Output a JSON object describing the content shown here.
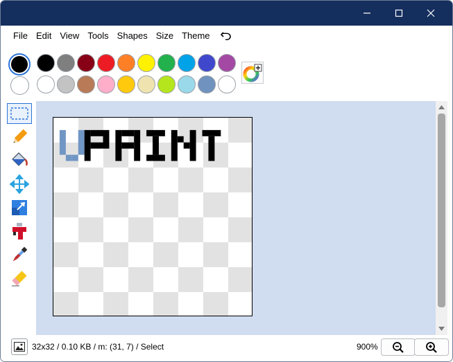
{
  "window": {
    "title": "",
    "controls": {
      "minimize": "minimize-icon",
      "maximize": "maximize-icon",
      "close": "close-icon"
    }
  },
  "menu": {
    "items": [
      "File",
      "Edit",
      "View",
      "Tools",
      "Shapes",
      "Size",
      "Theme"
    ],
    "undo_icon": "undo-icon"
  },
  "palette": {
    "primary_color": "#000000",
    "secondary_color": "#ffffff",
    "row1": [
      "#000000",
      "#7f7f7f",
      "#880015",
      "#ed1c24",
      "#ff7f27",
      "#fff200",
      "#22b14c",
      "#00a2e8",
      "#3f48cc",
      "#a349a4"
    ],
    "row2": [
      "#ffffff",
      "#c3c3c3",
      "#b97a57",
      "#ffaec9",
      "#ffc90e",
      "#efe4b0",
      "#b5e61d",
      "#99d9ea",
      "#7092be",
      "#ffffff"
    ],
    "picker_icon": "color-wheel-icon"
  },
  "tools": [
    {
      "name": "select",
      "icon": "select-rect-icon",
      "active": true
    },
    {
      "name": "pencil",
      "icon": "pencil-icon",
      "active": false
    },
    {
      "name": "fill",
      "icon": "paint-bucket-icon",
      "active": false
    },
    {
      "name": "move",
      "icon": "move-arrows-icon",
      "active": false
    },
    {
      "name": "resize",
      "icon": "resize-icon",
      "active": false
    },
    {
      "name": "spray",
      "icon": "spray-can-icon",
      "active": false
    },
    {
      "name": "eyedropper",
      "icon": "eyedropper-icon",
      "active": false
    },
    {
      "name": "eraser",
      "icon": "eraser-icon",
      "active": false
    }
  ],
  "canvas": {
    "logo_text": "VPAINT"
  },
  "status": {
    "text": "32x32 / 0.10 KB / m: (31, 7) / Select",
    "zoom": "900%",
    "zoom_out_icon": "zoom-out-icon",
    "zoom_in_icon": "zoom-in-icon"
  },
  "colors": {
    "titlebar": "#142e5e",
    "canvas_background": "#d0dcf0",
    "accent": "#2b74d8"
  }
}
